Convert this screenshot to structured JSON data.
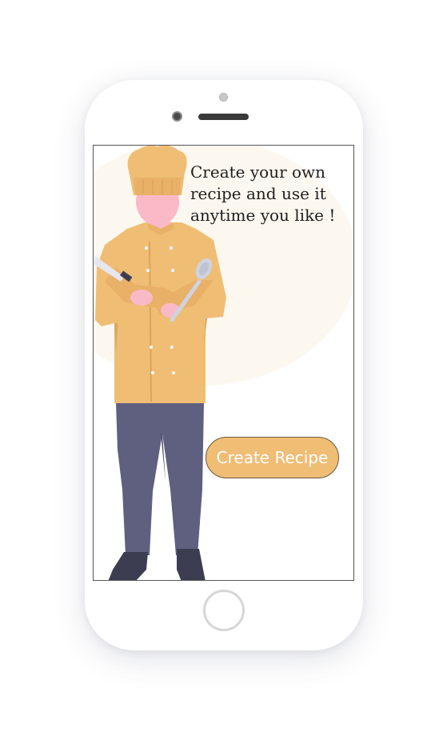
{
  "screen": {
    "headline": "Create your own recipe and use it anytime you like !",
    "cta_label": "Create Recipe"
  },
  "colors": {
    "accent": "#f0bd74",
    "background_blob": "#fdf8ef",
    "chef_jacket": "#f0bd74",
    "chef_pants": "#5f5f80",
    "skin": "#f9b9c6"
  },
  "illustration": {
    "subject": "chef-holding-knife-and-spoon"
  }
}
